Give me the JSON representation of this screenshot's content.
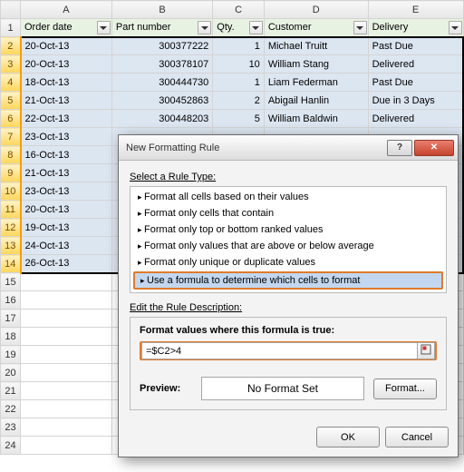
{
  "columns": [
    "A",
    "B",
    "C",
    "D",
    "E"
  ],
  "headers": {
    "A": "Order date",
    "B": "Part number",
    "C": "Qty.",
    "D": "Customer",
    "E": "Delivery"
  },
  "rows": [
    {
      "n": 1
    },
    {
      "n": 2,
      "A": "20-Oct-13",
      "B": "300377222",
      "C": "1",
      "D": "Michael Truitt",
      "E": "Past Due",
      "sel": true,
      "first": true
    },
    {
      "n": 3,
      "A": "20-Oct-13",
      "B": "300378107",
      "C": "10",
      "D": "William Stang",
      "E": "Delivered",
      "sel": true
    },
    {
      "n": 4,
      "A": "18-Oct-13",
      "B": "300444730",
      "C": "1",
      "D": "Liam Federman",
      "E": "Past Due",
      "sel": true
    },
    {
      "n": 5,
      "A": "21-Oct-13",
      "B": "300452863",
      "C": "2",
      "D": "Abigail Hanlin",
      "E": "Due in 3 Days",
      "sel": true
    },
    {
      "n": 6,
      "A": "22-Oct-13",
      "B": "300448203",
      "C": "5",
      "D": "William Baldwin",
      "E": "Delivered",
      "sel": true
    },
    {
      "n": 7,
      "A": "23-Oct-13",
      "sel": true
    },
    {
      "n": 8,
      "A": "16-Oct-13",
      "sel": true
    },
    {
      "n": 9,
      "A": "21-Oct-13",
      "sel": true
    },
    {
      "n": 10,
      "A": "23-Oct-13",
      "sel": true
    },
    {
      "n": 11,
      "A": "20-Oct-13",
      "sel": true
    },
    {
      "n": 12,
      "A": "19-Oct-13",
      "sel": true
    },
    {
      "n": 13,
      "A": "24-Oct-13",
      "sel": true
    },
    {
      "n": 14,
      "A": "26-Oct-13",
      "sel": true,
      "last": true
    },
    {
      "n": 15
    },
    {
      "n": 16
    },
    {
      "n": 17
    },
    {
      "n": 18
    },
    {
      "n": 19
    },
    {
      "n": 20
    },
    {
      "n": 21
    },
    {
      "n": 22
    },
    {
      "n": 23
    },
    {
      "n": 24
    }
  ],
  "dialog": {
    "title": "New Formatting Rule",
    "sectionSelect": "Select a Rule Type:",
    "rules": [
      "Format all cells based on their values",
      "Format only cells that contain",
      "Format only top or bottom ranked values",
      "Format only values that are above or below average",
      "Format only unique or duplicate values",
      "Use a formula to determine which cells to format"
    ],
    "selectedRuleIndex": 5,
    "sectionEdit": "Edit the Rule Description:",
    "formulaLabel": "Format values where this formula is true:",
    "formulaValue": "=$C2>4",
    "previewLabel": "Preview:",
    "previewText": "No Format Set",
    "formatBtn": "Format...",
    "ok": "OK",
    "cancel": "Cancel",
    "help": "?",
    "close": "✕"
  }
}
